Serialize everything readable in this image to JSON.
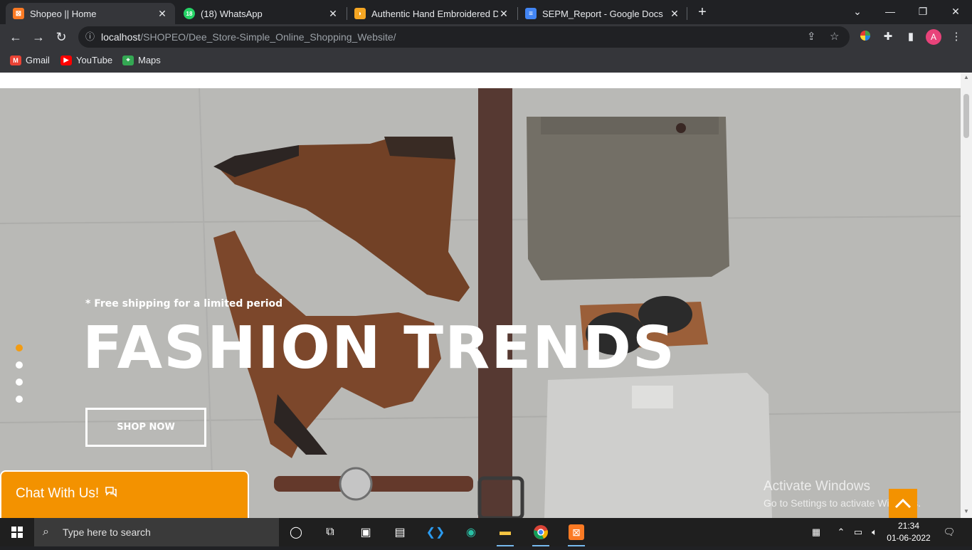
{
  "browser": {
    "tabs": [
      {
        "title": "Shopeo || Home",
        "icon": "xampp-icon",
        "active": true
      },
      {
        "title": "(18) WhatsApp",
        "icon": "whatsapp-icon",
        "badge": "18"
      },
      {
        "title": "Authentic Hand Embroidered De",
        "icon": "site-icon"
      },
      {
        "title": "SEPM_Report - Google Docs",
        "icon": "google-docs-icon"
      }
    ],
    "url_host": "localhost",
    "url_path": "/SHOPEO/Dee_Store-Simple_Online_Shopping_Website/",
    "profile_initial": "A",
    "bookmarks": [
      {
        "label": "Gmail",
        "icon": "gmail-icon"
      },
      {
        "label": "YouTube",
        "icon": "youtube-icon"
      },
      {
        "label": "Maps",
        "icon": "maps-icon"
      }
    ]
  },
  "hero": {
    "promo": "* Free shipping for a limited period",
    "headline": "FASHION TRENDS",
    "cta": "SHOP NOW",
    "slides": 4,
    "active_slide": 1
  },
  "chat": {
    "label": "Chat With Us!"
  },
  "watermark": {
    "title": "Activate Windows",
    "subtitle": "Go to Settings to activate Windows."
  },
  "taskbar": {
    "search_placeholder": "Type here to search",
    "time": "21:34",
    "date": "01-06-2022"
  },
  "colors": {
    "accent": "#f39200",
    "active_dot": "#f39c12",
    "chrome_dark": "#202124",
    "chrome_toolbar": "#35363a"
  }
}
